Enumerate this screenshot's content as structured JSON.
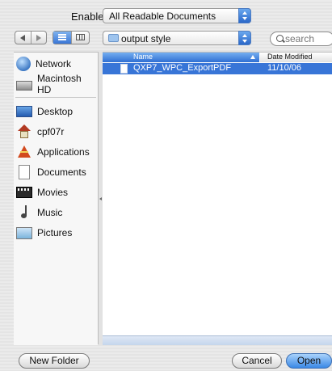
{
  "enable": {
    "label": "Enable:",
    "selected": "All Readable Documents"
  },
  "toolbar": {
    "path_selected": "output style",
    "search_placeholder": "search"
  },
  "sidebar": {
    "devices": [
      {
        "label": "Network",
        "icon": "network-icon"
      },
      {
        "label": "Macintosh HD",
        "icon": "hard-drive-icon"
      }
    ],
    "places": [
      {
        "label": "Desktop",
        "icon": "desktop-icon"
      },
      {
        "label": "cpf07r",
        "icon": "home-icon"
      },
      {
        "label": "Applications",
        "icon": "applications-icon"
      },
      {
        "label": "Documents",
        "icon": "documents-icon"
      },
      {
        "label": "Movies",
        "icon": "movies-icon"
      },
      {
        "label": "Music",
        "icon": "music-icon"
      },
      {
        "label": "Pictures",
        "icon": "pictures-icon"
      }
    ]
  },
  "filelist": {
    "columns": {
      "name": "Name",
      "date": "Date Modified"
    },
    "rows": [
      {
        "name": "QXP7_WPC_ExportPDF",
        "date": "11/10/06"
      }
    ]
  },
  "buttons": {
    "new_folder": "New Folder",
    "cancel": "Cancel",
    "open": "Open"
  },
  "colors": {
    "selection": "#3875d7",
    "accent": "#2f6fd3"
  }
}
